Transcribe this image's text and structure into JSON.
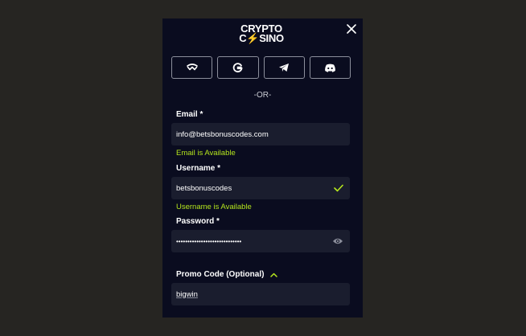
{
  "logo": {
    "line1": "CRYPTO",
    "line2_a": "C",
    "line2_bolt": "⚡",
    "line2_b": "SINO"
  },
  "social": {
    "buttons": [
      {
        "icon": "walletconnect-icon"
      },
      {
        "icon": "google-icon"
      },
      {
        "icon": "telegram-icon"
      },
      {
        "icon": "discord-icon"
      }
    ]
  },
  "separator": "-OR-",
  "email": {
    "label": "Email *",
    "value": "info@betsbonuscodes.com",
    "status": "Email is Available"
  },
  "username": {
    "label": "Username *",
    "value": "betsbonuscodes",
    "status": "Username is Available"
  },
  "password": {
    "label": "Password *",
    "value": "•••••••••••••••••••••••••••••"
  },
  "promo": {
    "label": "Promo Code (Optional)",
    "value": "bigwin"
  },
  "colors": {
    "background": "#262522",
    "modal": "#0a0c1f",
    "field": "#1a1d2e",
    "accent_green": "#b5e61d",
    "border": "#8c8f9c"
  }
}
